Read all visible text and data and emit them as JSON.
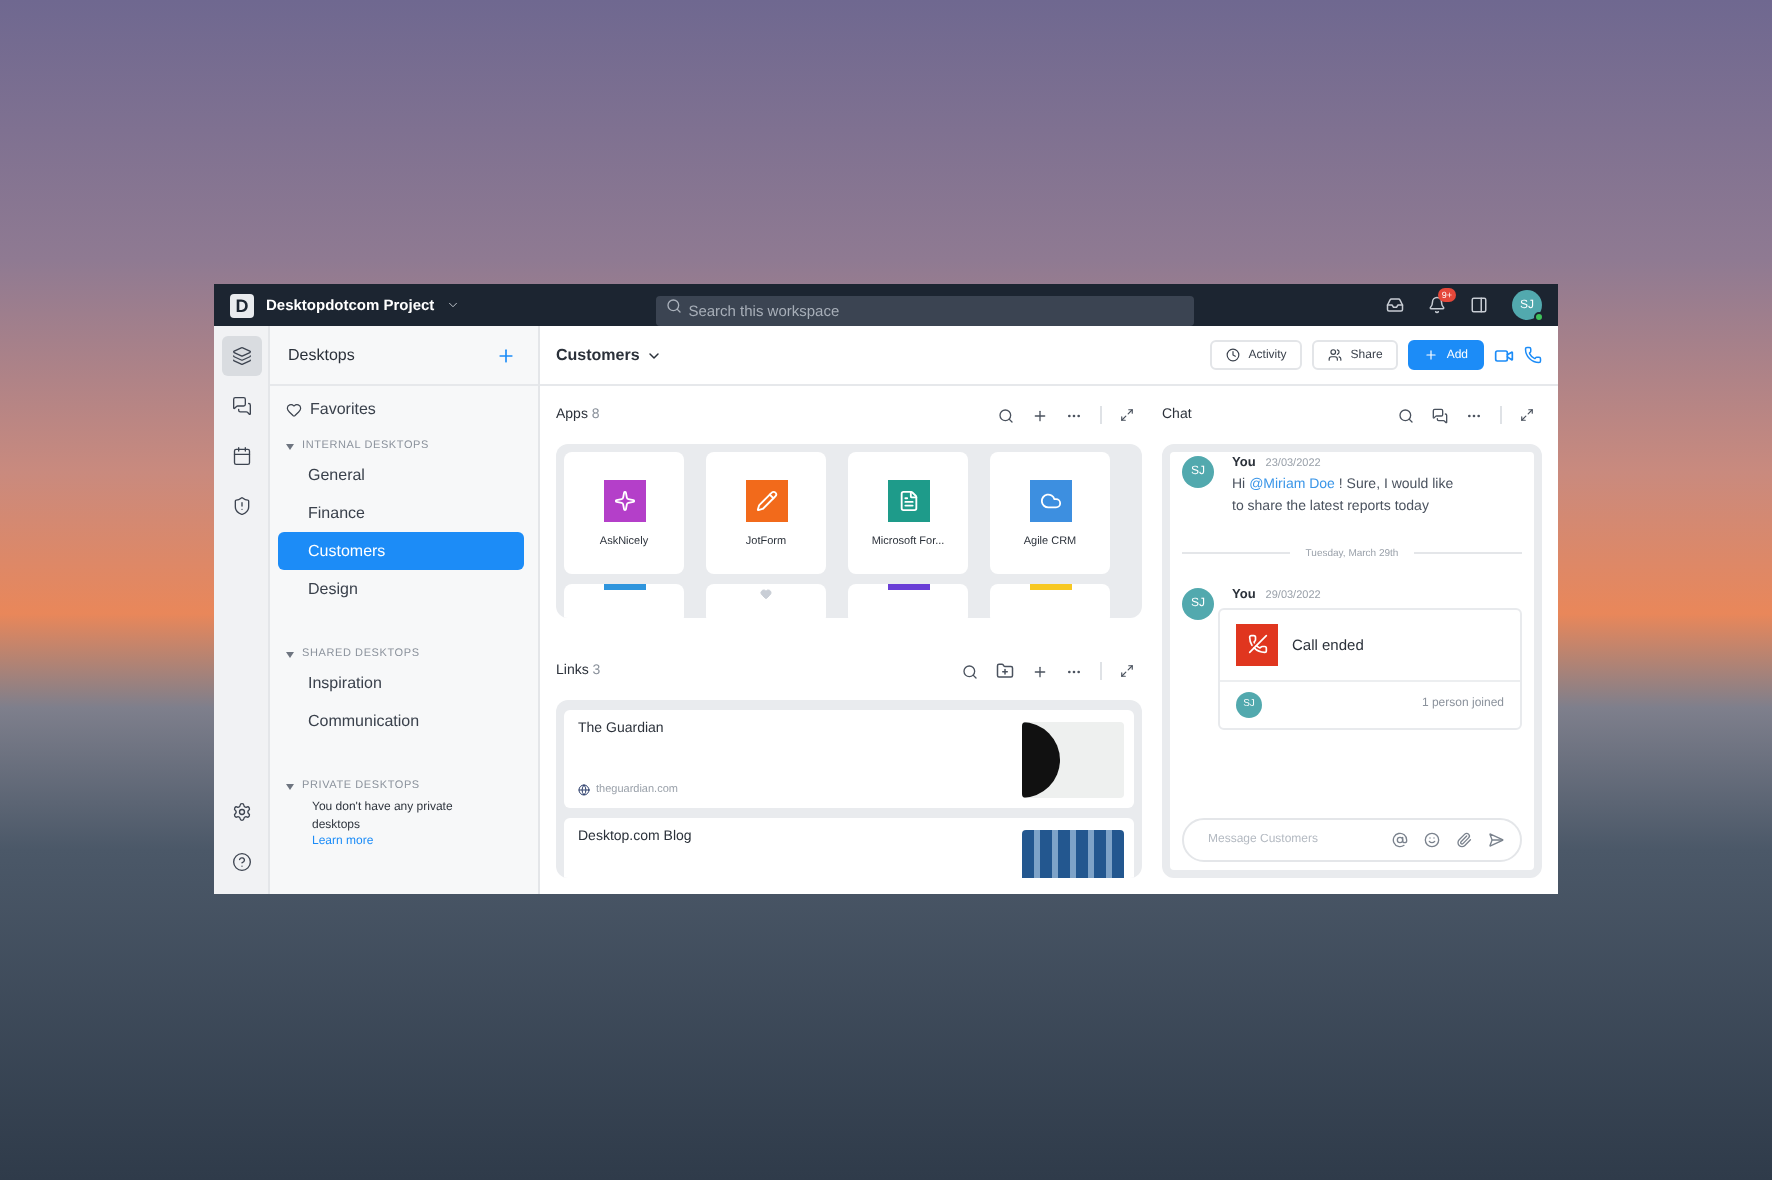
{
  "topbar": {
    "workspace_initial": "D",
    "workspace": "Desktopdotcom Project",
    "search_placeholder": "Search this workspace",
    "notification_badge": "9+",
    "avatar": "SJ",
    "online": true
  },
  "rail": [
    {
      "kind": "desktops",
      "selected": true
    },
    {
      "kind": "chat",
      "selected": false
    },
    {
      "kind": "calendar",
      "selected": false
    },
    {
      "kind": "security",
      "selected": false
    }
  ],
  "sidebar": {
    "title": "Desktops",
    "favorites": "Favorites",
    "groups": [
      {
        "label": "INTERNAL DESKTOPS",
        "expanded": true,
        "items": [
          {
            "label": "General",
            "selected": false
          },
          {
            "label": "Finance",
            "selected": false
          },
          {
            "label": "Customers",
            "selected": true
          },
          {
            "label": "Design",
            "selected": false
          }
        ]
      },
      {
        "label": "SHARED DESKTOPS",
        "expanded": true,
        "items": [
          {
            "label": "Inspiration",
            "selected": false
          },
          {
            "label": "Communication",
            "selected": false
          }
        ]
      },
      {
        "label": "PRIVATE DESKTOPS",
        "expanded": true,
        "note": "You don't have any private desktops",
        "link": "Learn more"
      }
    ]
  },
  "header": {
    "desktop": "Customers",
    "buttons": [
      {
        "kind": "activity",
        "label": "Activity"
      },
      {
        "kind": "share",
        "label": "Share"
      },
      {
        "kind": "add",
        "label": "Add"
      }
    ]
  },
  "apps": {
    "title": "Apps",
    "count": "8",
    "items": [
      {
        "name": "AskNicely",
        "kind": "star",
        "color": "#b43fc9"
      },
      {
        "name": "JotForm",
        "kind": "pencil",
        "color": "#f26a1b"
      },
      {
        "name": "Microsoft For...",
        "kind": "document",
        "color": "#1e9b8a"
      },
      {
        "name": "Agile CRM",
        "kind": "cloud",
        "color": "#3d8fe0"
      }
    ],
    "more": [
      {
        "kind": "bar",
        "color": "#2f95dd"
      },
      {
        "kind": "heart",
        "color": "#c9ced6"
      },
      {
        "kind": "bar",
        "color": "#6a3fd6"
      },
      {
        "kind": "bar",
        "color": "#f7c823"
      }
    ]
  },
  "links": {
    "title": "Links",
    "count": "3",
    "items": [
      {
        "title": "The Guardian",
        "domain": "theguardian.com",
        "kind": "newspaper"
      },
      {
        "title": "Desktop.com Blog",
        "kind": "blog"
      }
    ]
  },
  "chat": {
    "title": "Chat",
    "items": [
      {
        "kind": "message",
        "avatar": "SJ",
        "author": "You",
        "date": "23/03/2022",
        "before": "Hi ",
        "mention": "@Miriam Doe",
        "after": " ! Sure, I would like to share the latest reports today"
      },
      {
        "kind": "divider",
        "label": "Tuesday, March 29th"
      },
      {
        "kind": "call",
        "avatar": "SJ",
        "author": "You",
        "date": "29/03/2022",
        "status": "Call ended",
        "participant": "SJ",
        "joined": "1 person joined"
      }
    ],
    "input_placeholder": "Message Customers"
  }
}
